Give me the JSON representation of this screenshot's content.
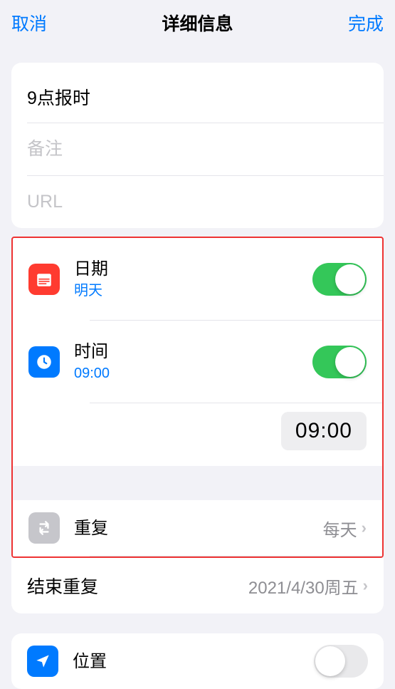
{
  "header": {
    "cancel": "取消",
    "title": "详细信息",
    "done": "完成"
  },
  "fields": {
    "title_value": "9点报时",
    "notes_placeholder": "备注",
    "url_placeholder": "URL"
  },
  "date": {
    "label": "日期",
    "value": "明天",
    "enabled": true
  },
  "time": {
    "label": "时间",
    "value": "09:00",
    "picker_value": "09:00",
    "enabled": true
  },
  "repeat": {
    "label": "重复",
    "value": "每天"
  },
  "end_repeat": {
    "label": "结束重复",
    "value": "2021/4/30周五"
  },
  "location": {
    "label": "位置",
    "enabled": false
  }
}
